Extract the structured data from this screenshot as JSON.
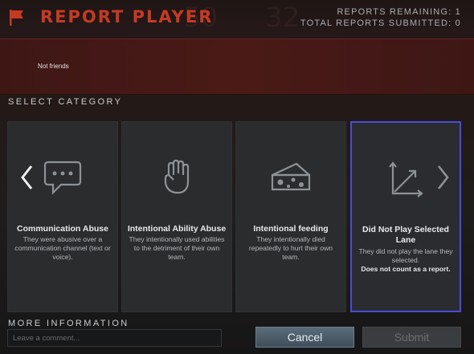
{
  "header": {
    "title": "REPORT PLAYER",
    "reports_remaining_label": "REPORTS REMAINING: 1",
    "total_submitted_label": "TOTAL REPORTS SUBMITTED: 0",
    "icon": "flag-icon",
    "accent_color": "#c53a23"
  },
  "player": {
    "status": "Not friends"
  },
  "category": {
    "section_label": "SELECT CATEGORY",
    "selected_index": 3,
    "items": [
      {
        "title": "Communication Abuse",
        "description": "They were abusive over a communication channel (text or voice).",
        "icon": "chat-bubble-icon"
      },
      {
        "title": "Intentional Ability Abuse",
        "description": "They intentionally used abilities to the detriment of their own team.",
        "icon": "fist-icon"
      },
      {
        "title": "Intentional feeding",
        "description": "They intentionally died repeatedly to hurt their own team.",
        "icon": "cheese-icon"
      },
      {
        "title": "Did Not Play Selected Lane",
        "description": "They did not play the lane they selected.",
        "note": "Does not count as a report.",
        "icon": "lane-axes-icon"
      }
    ],
    "selected_border_color": "#4a4cd6"
  },
  "more_info": {
    "section_label": "MORE INFORMATION",
    "comment_placeholder": "Leave a comment..."
  },
  "actions": {
    "cancel_label": "Cancel",
    "submit_label": "Submit"
  }
}
